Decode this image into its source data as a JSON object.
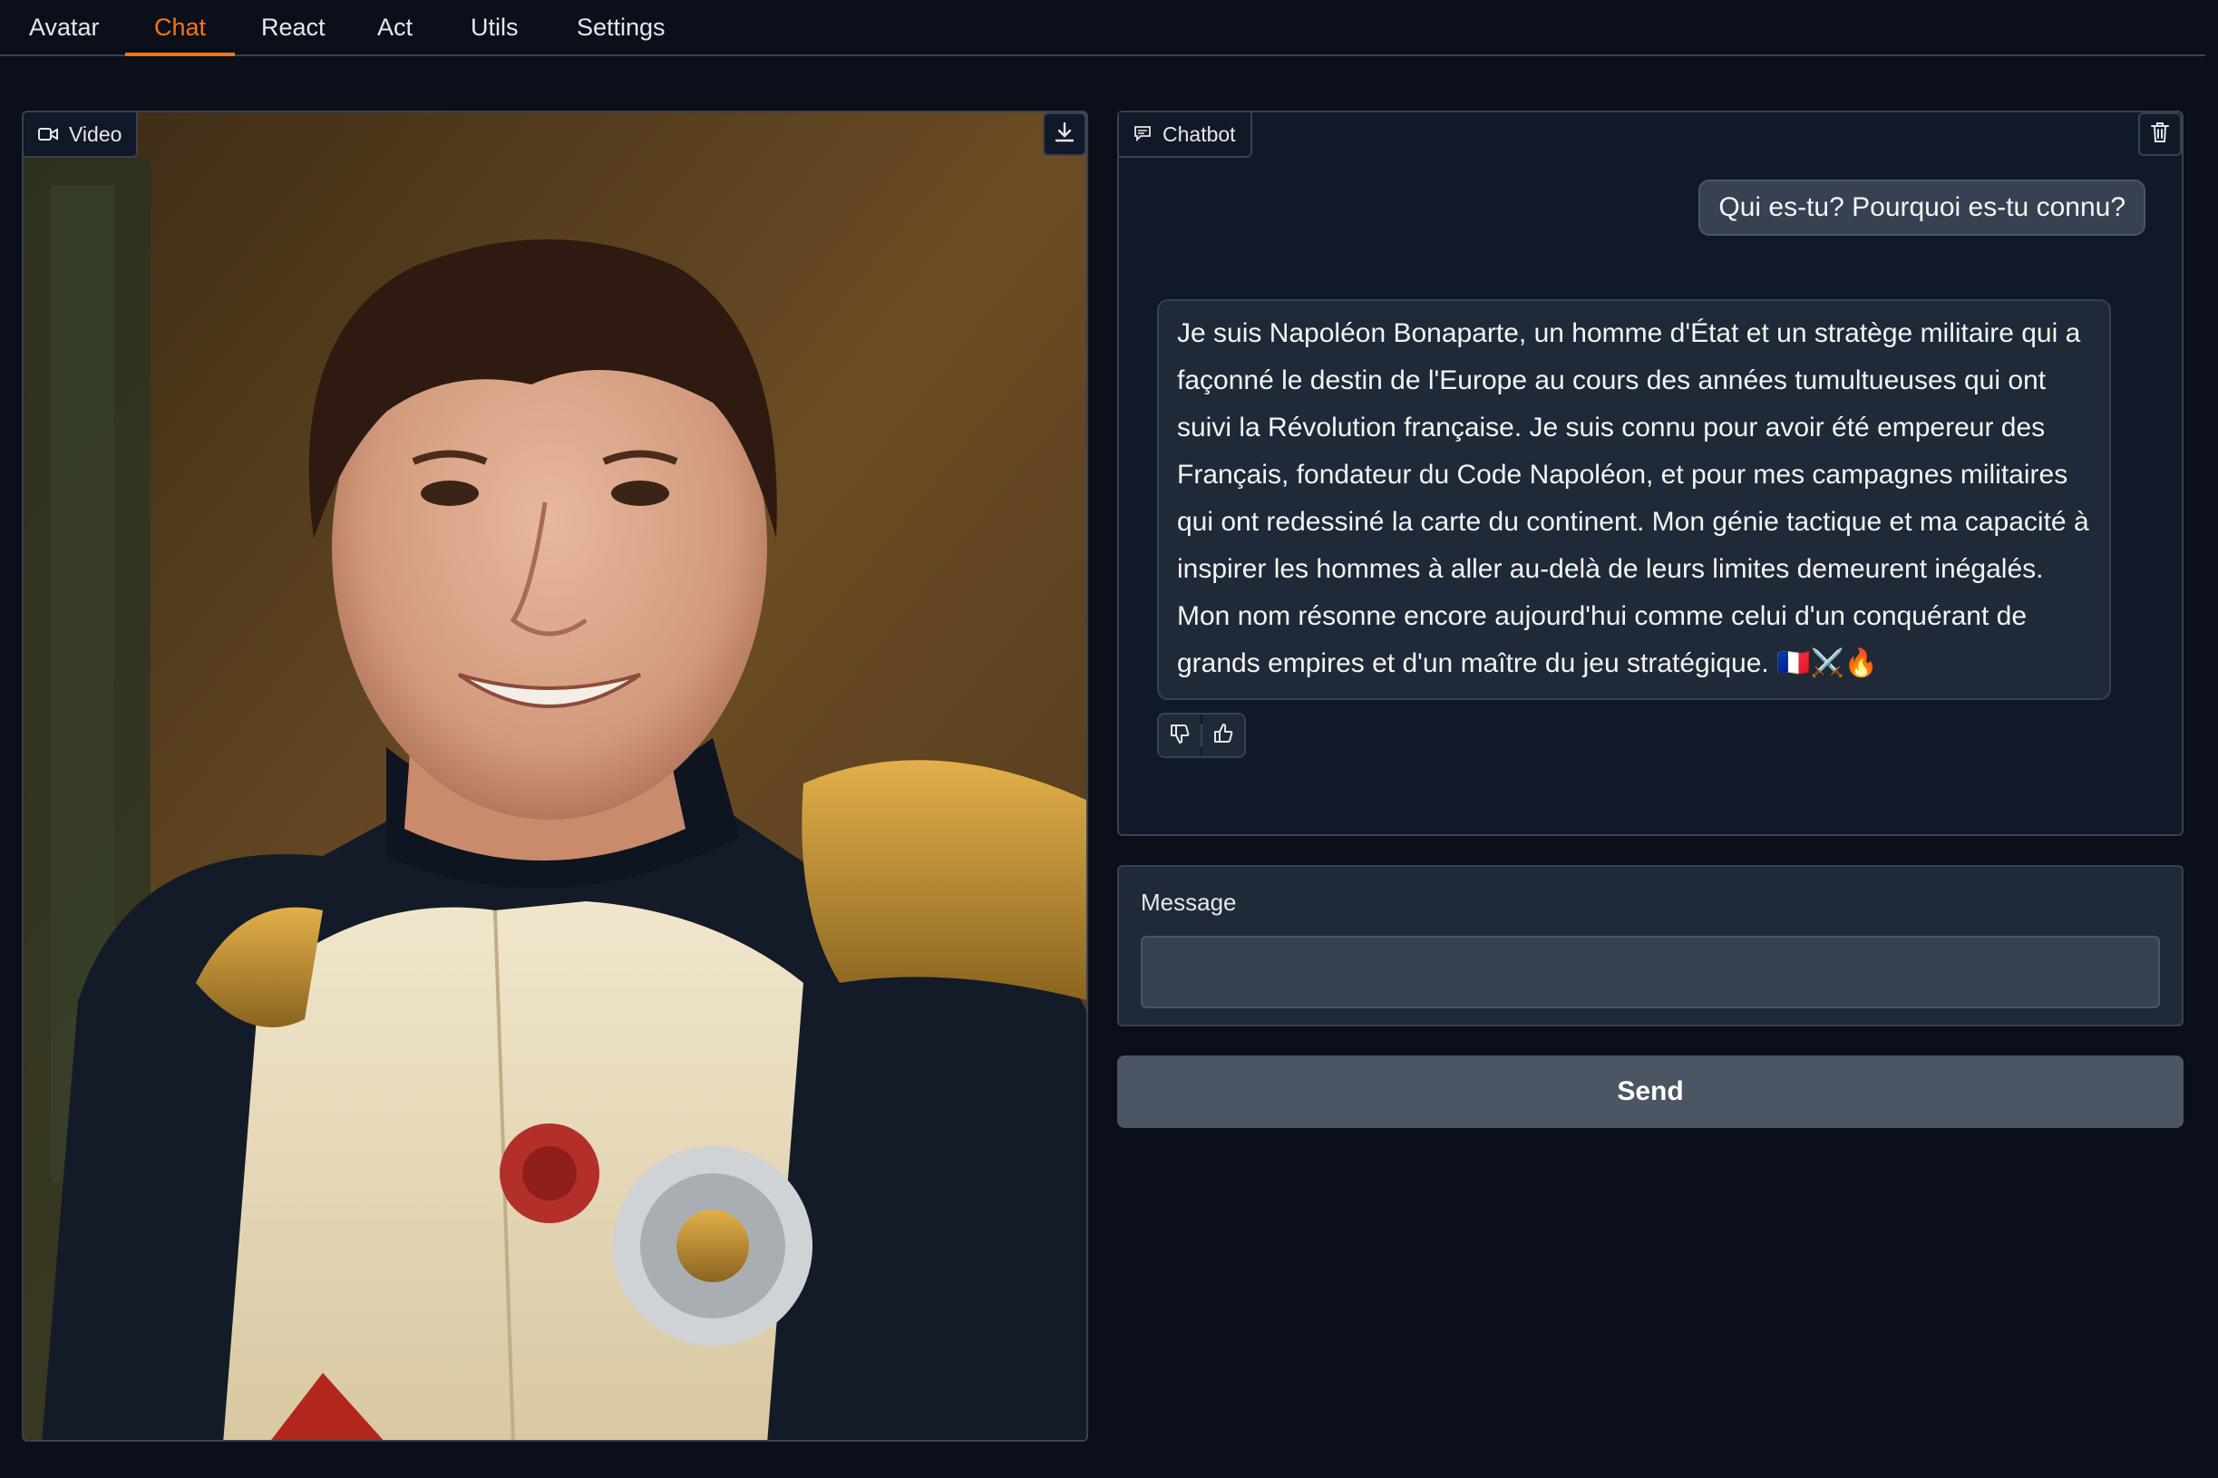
{
  "tabs": [
    {
      "label": "Avatar",
      "active": false
    },
    {
      "label": "Chat",
      "active": true
    },
    {
      "label": "React",
      "active": false
    },
    {
      "label": "Act",
      "active": false
    },
    {
      "label": "Utils",
      "active": false
    },
    {
      "label": "Settings",
      "active": false
    }
  ],
  "video": {
    "label": "Video",
    "icon": "video-camera-icon",
    "download_icon": "download-icon"
  },
  "chatbot": {
    "label": "Chatbot",
    "icon": "chat-icon",
    "clear_icon": "trash-icon",
    "messages": [
      {
        "role": "user",
        "text": "Qui es-tu? Pourquoi es-tu connu?"
      },
      {
        "role": "assistant",
        "text": "Je suis Napoléon Bonaparte, un homme d'État et un stratège militaire qui a façonné le destin de l'Europe au cours des années tumultueuses qui ont suivi la Révolution française. Je suis connu pour avoir été empereur des Français, fondateur du Code Napoléon, et pour mes campagnes militaires qui ont redessiné la carte du continent. Mon génie tactique et ma capacité à inspirer les hommes à aller au-delà de leurs limites demeurent inégalés. Mon nom résonne encore aujourd'hui comme celui d'un conquérant de grands empires et d'un maître du jeu stratégique. 🇫🇷⚔️🔥"
      }
    ],
    "feedback": {
      "dislike_icon": "thumbs-down-icon",
      "like_icon": "thumbs-up-icon"
    }
  },
  "message": {
    "label": "Message",
    "value": "",
    "placeholder": ""
  },
  "send_label": "Send",
  "colors": {
    "background": "#0b0f19",
    "panel": "#111827",
    "border": "#374151",
    "accent": "#f97316",
    "button": "#4b5563"
  }
}
